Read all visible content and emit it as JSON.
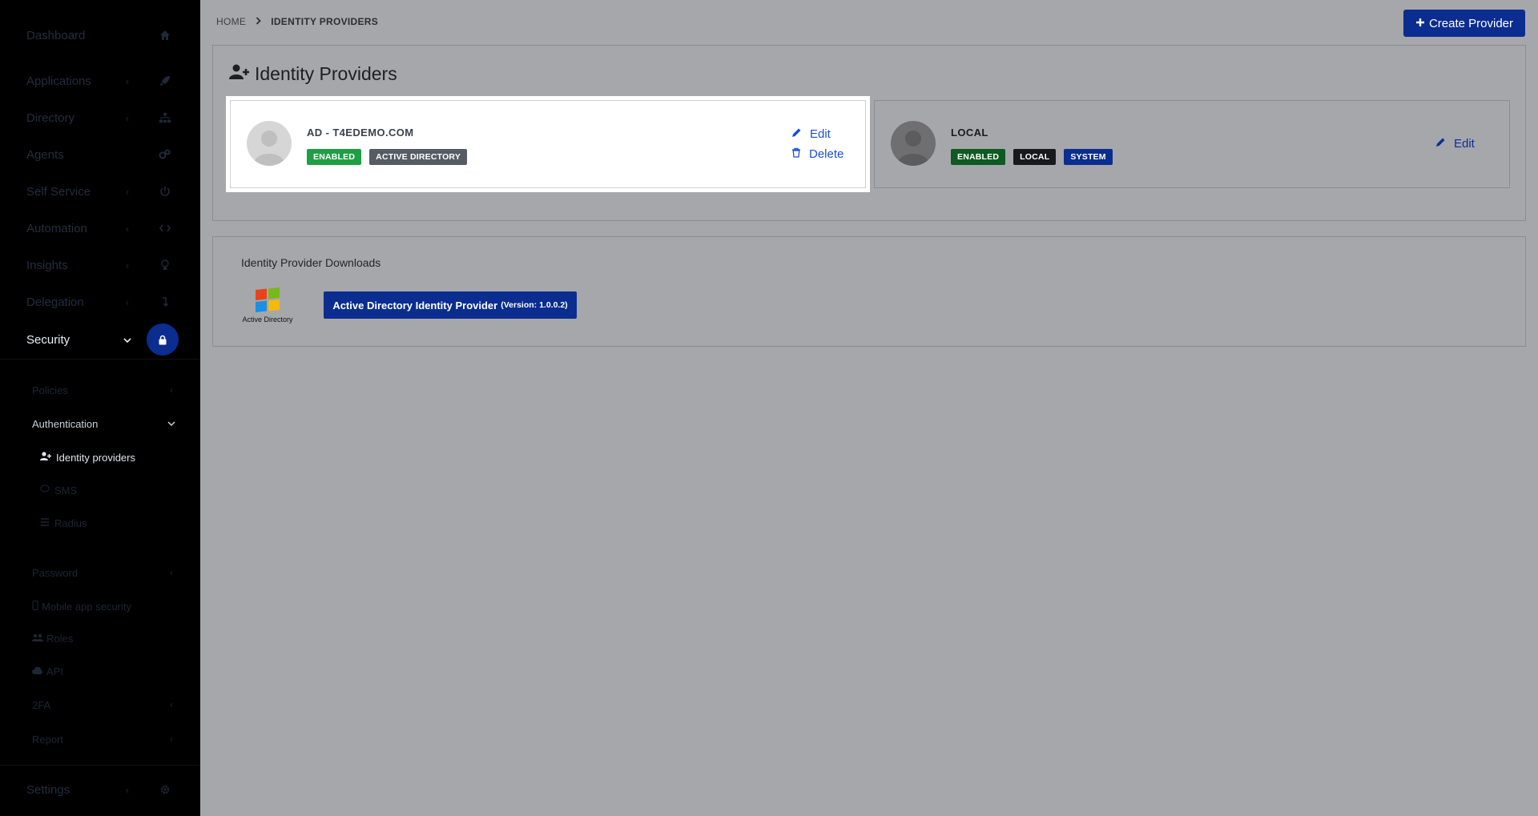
{
  "sidebar": {
    "items": [
      {
        "label": "Dashboard",
        "icon": "home-icon"
      },
      {
        "label": "Applications",
        "icon": "rocket-icon"
      },
      {
        "label": "Directory",
        "icon": "sitemap-icon"
      },
      {
        "label": "Agents",
        "icon": "cogs-icon"
      },
      {
        "label": "Self Service",
        "icon": "power-icon"
      },
      {
        "label": "Automation",
        "icon": "code-icon"
      },
      {
        "label": "Insights",
        "icon": "lightbulb-icon"
      },
      {
        "label": "Delegation",
        "icon": "arrow-icon"
      },
      {
        "label": "Security",
        "icon": "lock-icon"
      },
      {
        "label": "Settings",
        "icon": "gear-icon"
      }
    ],
    "security_sub": {
      "policies": "Policies",
      "authentication": "Authentication",
      "identity_providers": "Identity providers",
      "sms": "SMS",
      "radius": "Radius",
      "password": "Password",
      "mobile_app_security": "Mobile app security",
      "roles": "Roles",
      "api": "API",
      "twofa": "2FA",
      "report": "Report"
    }
  },
  "breadcrumb": {
    "home": "HOME",
    "current": "IDENTITY PROVIDERS"
  },
  "header": {
    "create_label": "Create Provider"
  },
  "page": {
    "title": "Identity Providers"
  },
  "providers": [
    {
      "name": "AD - T4EDEMO.COM",
      "badges": [
        {
          "label": "ENABLED",
          "color": "#1e9e45"
        },
        {
          "label": "ACTIVE DIRECTORY",
          "color": "#565c64"
        }
      ],
      "edit": "Edit",
      "delete": "Delete"
    },
    {
      "name": "LOCAL",
      "badges": [
        {
          "label": "ENABLED",
          "color": "#0e5a20"
        },
        {
          "label": "LOCAL",
          "color": "#16191d"
        },
        {
          "label": "SYSTEM",
          "color": "#0a2d8f"
        }
      ],
      "edit": "Edit"
    }
  ],
  "downloads": {
    "title": "Identity Provider Downloads",
    "logo_caption": "Active Directory",
    "button_label": "Active Directory Identity Provider",
    "button_version": "(Version: 1.0.0.2)"
  },
  "colors": {
    "accent": "#0a2d8f",
    "link": "#1a4fd6",
    "overlay_bg": "#a6a7ab"
  }
}
